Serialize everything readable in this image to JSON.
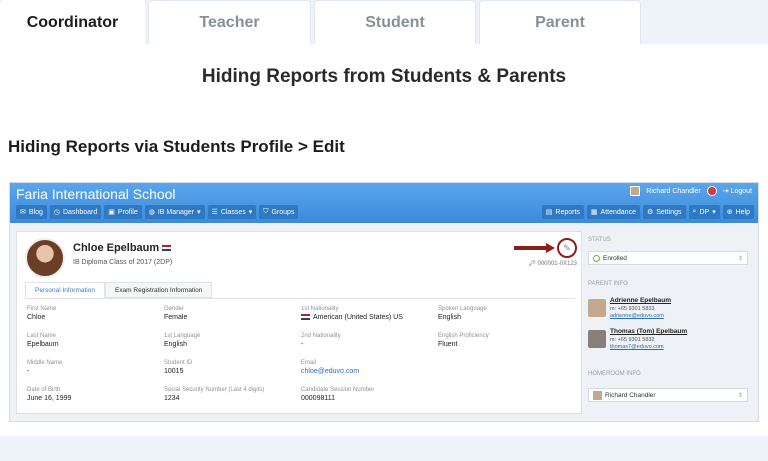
{
  "tabs": [
    {
      "label": "Coordinator",
      "active": true
    },
    {
      "label": "Teacher",
      "active": false
    },
    {
      "label": "Student",
      "active": false
    },
    {
      "label": "Parent",
      "active": false
    }
  ],
  "page_title": "Hiding Reports from Students & Parents",
  "section_title": "Hiding Reports via Students Profile > Edit",
  "app": {
    "school_name": "Faria International School",
    "user_name": "Richard Chandler",
    "logout_label": "Logout",
    "nav_left": [
      "Blog",
      "Dashboard",
      "Profile",
      "IB Manager",
      "Classes",
      "Groups"
    ],
    "nav_right": [
      "Reports",
      "Attendance",
      "Settings",
      "DP",
      "Help"
    ]
  },
  "student": {
    "name": "Chloe Epelbaum",
    "class": "IB Diploma Class of 2017 (2DP)",
    "id": "000001-0X123"
  },
  "subtabs": [
    "Personal Information",
    "Exam Registration Information"
  ],
  "fields": [
    {
      "label": "First Name",
      "value": "Chloe"
    },
    {
      "label": "Gender",
      "value": "Female"
    },
    {
      "label": "1st Nationality",
      "value": "American (United States) US"
    },
    {
      "label": "Spoken Language",
      "value": "English"
    },
    {
      "label": "Last Name",
      "value": "Epelbaum"
    },
    {
      "label": "1st Language",
      "value": "English"
    },
    {
      "label": "2nd Nationality",
      "value": "-"
    },
    {
      "label": "English Proficiency",
      "value": "Fluent"
    },
    {
      "label": "Middle Name",
      "value": "-"
    },
    {
      "label": "Student ID",
      "value": "10015"
    },
    {
      "label": "Email",
      "value": "chloe@eduvo.com"
    },
    {
      "label": "Date of Birth",
      "value": "June 16, 1999"
    },
    {
      "label": "Social Security Number (Last 4 digits)",
      "value": "1234"
    },
    {
      "label": "Candidate Session Number",
      "value": "000098111"
    }
  ],
  "sidebar": {
    "status_label": "STATUS",
    "status_value": "Enrolled",
    "parent_info_label": "PARENT INFO",
    "parents": [
      {
        "name": "Adrienne Epelbaum",
        "phone": "m: +65 9301 5833",
        "email": "adrienne@eduvo.com"
      },
      {
        "name": "Thomas (Tom) Epelbaum",
        "phone": "m: +65 9301 5832",
        "email": "thomas7@eduvo.com"
      }
    ],
    "homeroom_label": "HOMEROOM INFO",
    "homeroom_value": "Richard Chandler"
  },
  "colors": {
    "app_bar": "#3c8ad9",
    "arrow": "#8c1d1d",
    "link": "#2d6fb8"
  }
}
